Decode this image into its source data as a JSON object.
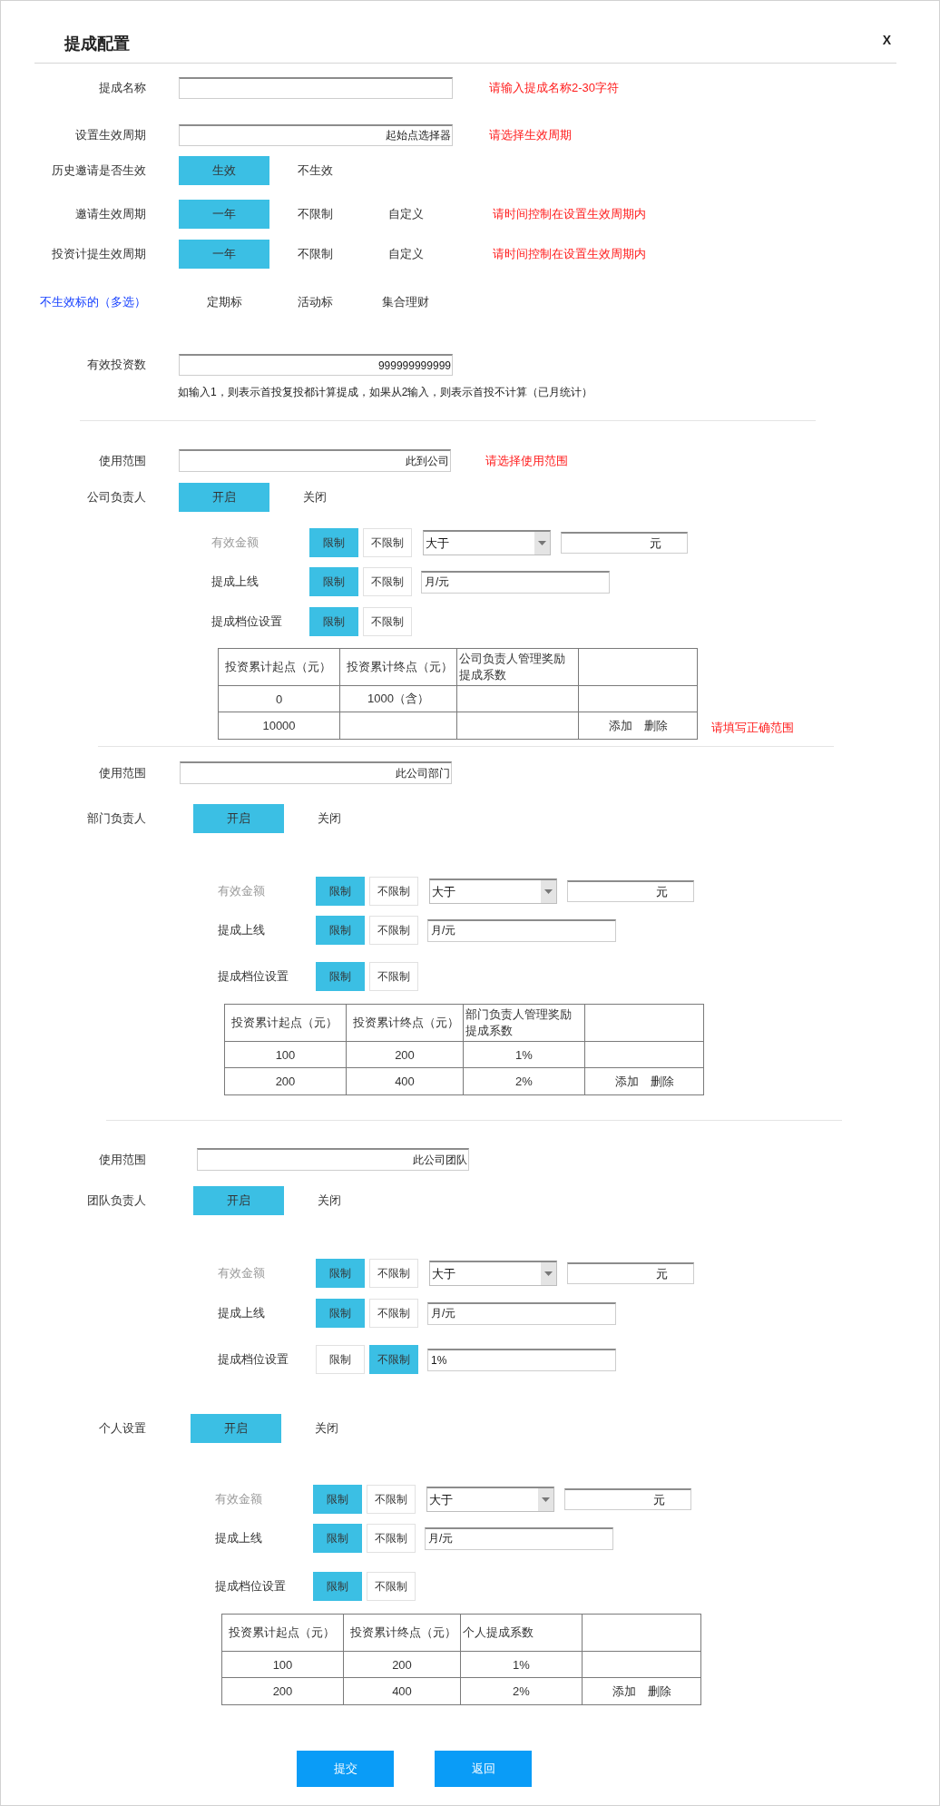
{
  "dialog": {
    "title": "提成配置",
    "close": "X"
  },
  "general": [
    {
      "kind": "field",
      "label": "提成名称",
      "hint": "请输入提成名称2-30字符"
    },
    {
      "kind": "field",
      "label": "设置生效周期",
      "value": "起始点选择器",
      "hint": "请选择生效周期"
    },
    {
      "kind": "choice",
      "label": "历史邀请是否生效",
      "options": [
        {
          "label": "生效",
          "selected": true
        },
        {
          "label": "不生效",
          "selected": false
        }
      ]
    },
    {
      "kind": "choice",
      "label": "邀请生效周期",
      "options": [
        {
          "label": "一年",
          "selected": true
        },
        {
          "label": "不限制",
          "selected": false
        },
        {
          "label": "自定义",
          "selected": false
        }
      ],
      "hint": "请时间控制在设置生效周期内"
    },
    {
      "kind": "choice",
      "label": "投资计提生效周期",
      "options": [
        {
          "label": "一年",
          "selected": true
        },
        {
          "label": "不限制",
          "selected": false
        },
        {
          "label": "自定义",
          "selected": false
        }
      ],
      "hint": "请时间控制在设置生效周期内"
    },
    {
      "kind": "multi-choice",
      "label": "不生效标的（多选）",
      "options": [
        {
          "label": "定期标",
          "selected": false
        },
        {
          "label": "活动标",
          "selected": false
        },
        {
          "label": "集合理财",
          "selected": false
        }
      ]
    },
    {
      "kind": "field",
      "label": "有效投资数",
      "value": "999999999999",
      "note": "如输入1，则表示首投复投都计算提成，如果从2输入，则表示首投不计算（已月统计）"
    }
  ],
  "sections": [
    {
      "scope": {
        "label": "使用范围",
        "value": "此到公司",
        "hint": "请选择使用范围"
      },
      "switch": {
        "label": "公司负责人",
        "options": [
          {
            "label": "开启",
            "selected": true
          },
          {
            "label": "关闭",
            "selected": false
          }
        ]
      },
      "limits": [
        {
          "kind": "amount",
          "label": "有效金额",
          "disabled": true,
          "options": [
            {
              "label": "限制",
              "selected": true
            },
            {
              "label": "不限制",
              "selected": false
            }
          ],
          "comparator": "大于",
          "unit": "元"
        },
        {
          "kind": "text",
          "label": "提成上线",
          "disabled": false,
          "options": [
            {
              "label": "限制",
              "selected": true
            },
            {
              "label": "不限制",
              "selected": false
            }
          ],
          "value": "月/元"
        },
        {
          "kind": "toggle",
          "label": "提成档位设置",
          "disabled": false,
          "options": [
            {
              "label": "限制",
              "selected": true
            },
            {
              "label": "不限制",
              "selected": false
            }
          ]
        }
      ],
      "table": {
        "columns": [
          "投资累计起点（元）",
          "投资累计终点（元）",
          "公司负责人管理奖励提成系数"
        ],
        "rows": [
          {
            "cells": [
              "0",
              "1000（含）",
              null
            ]
          },
          {
            "cells": [
              "10000",
              null,
              null
            ],
            "actions": {
              "add": "添加",
              "delete": "删除"
            }
          }
        ],
        "hint": "请填写正确范围"
      }
    },
    {
      "scope": {
        "label": "使用范围",
        "value": "此公司部门"
      },
      "switch": {
        "label": "部门负责人",
        "options": [
          {
            "label": "开启",
            "selected": true
          },
          {
            "label": "关闭",
            "selected": false
          }
        ]
      },
      "limits": [
        {
          "kind": "amount",
          "label": "有效金额",
          "disabled": true,
          "options": [
            {
              "label": "限制",
              "selected": true
            },
            {
              "label": "不限制",
              "selected": false
            }
          ],
          "comparator": "大于",
          "unit": "元"
        },
        {
          "kind": "text",
          "label": "提成上线",
          "disabled": false,
          "options": [
            {
              "label": "限制",
              "selected": true
            },
            {
              "label": "不限制",
              "selected": false
            }
          ],
          "value": "月/元"
        },
        {
          "kind": "toggle",
          "label": "提成档位设置",
          "disabled": false,
          "options": [
            {
              "label": "限制",
              "selected": true
            },
            {
              "label": "不限制",
              "selected": false
            }
          ]
        }
      ],
      "table": {
        "columns": [
          "投资累计起点（元）",
          "投资累计终点（元）",
          "部门负责人管理奖励提成系数"
        ],
        "rows": [
          {
            "cells": [
              "100",
              "200",
              "1%"
            ]
          },
          {
            "cells": [
              "200",
              "400",
              "2%"
            ],
            "actions": {
              "add": "添加",
              "delete": "删除"
            }
          }
        ]
      }
    },
    {
      "scope": {
        "label": "使用范围",
        "value": "此公司团队"
      },
      "switch": {
        "label": "团队负责人",
        "options": [
          {
            "label": "开启",
            "selected": true
          },
          {
            "label": "关闭",
            "selected": false
          }
        ]
      },
      "limits": [
        {
          "kind": "amount",
          "label": "有效金额",
          "disabled": true,
          "options": [
            {
              "label": "限制",
              "selected": true
            },
            {
              "label": "不限制",
              "selected": false
            }
          ],
          "comparator": "大于",
          "unit": "元"
        },
        {
          "kind": "text",
          "label": "提成上线",
          "disabled": false,
          "options": [
            {
              "label": "限制",
              "selected": true
            },
            {
              "label": "不限制",
              "selected": false
            }
          ],
          "value": "月/元"
        },
        {
          "kind": "text",
          "label": "提成档位设置",
          "disabled": false,
          "options": [
            {
              "label": "限制",
              "selected": false
            },
            {
              "label": "不限制",
              "selected": true
            }
          ],
          "value": "1%"
        }
      ]
    },
    {
      "switch": {
        "label": "个人设置",
        "options": [
          {
            "label": "开启",
            "selected": true
          },
          {
            "label": "关闭",
            "selected": false
          }
        ]
      },
      "limits": [
        {
          "kind": "amount",
          "label": "有效金额",
          "disabled": true,
          "options": [
            {
              "label": "限制",
              "selected": true
            },
            {
              "label": "不限制",
              "selected": false
            }
          ],
          "comparator": "大于",
          "unit": "元"
        },
        {
          "kind": "text",
          "label": "提成上线",
          "disabled": false,
          "options": [
            {
              "label": "限制",
              "selected": true
            },
            {
              "label": "不限制",
              "selected": false
            }
          ],
          "value": "月/元"
        },
        {
          "kind": "toggle",
          "label": "提成档位设置",
          "disabled": false,
          "options": [
            {
              "label": "限制",
              "selected": true
            },
            {
              "label": "不限制",
              "selected": false
            }
          ]
        }
      ],
      "table": {
        "columns": [
          "投资累计起点（元）",
          "投资累计终点（元）",
          "个人提成系数"
        ],
        "rows": [
          {
            "cells": [
              "100",
              "200",
              "1%"
            ]
          },
          {
            "cells": [
              "200",
              "400",
              "2%"
            ],
            "actions": {
              "add": "添加",
              "delete": "删除"
            }
          }
        ]
      }
    }
  ],
  "footer": {
    "submit": "提交",
    "back": "返回"
  }
}
